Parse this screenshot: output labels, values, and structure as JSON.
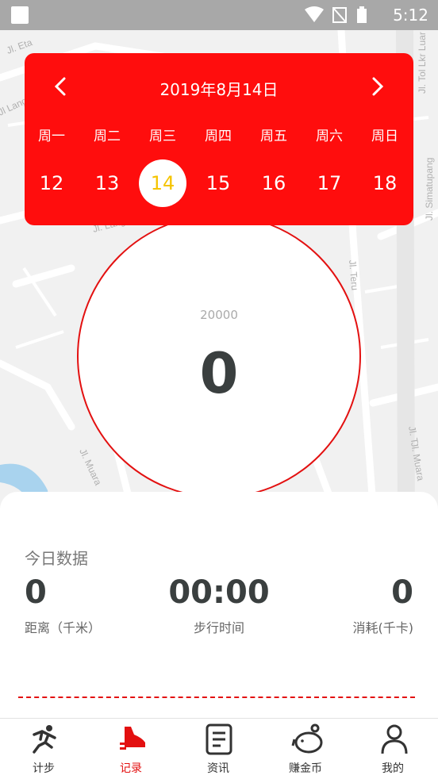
{
  "status_bar": {
    "time": "5:12"
  },
  "map": {
    "street_labels": [
      "Jl. Eta",
      "Jl. Langg",
      "Jl Langgu",
      "Jl. Teru",
      "Jl. Muara",
      "Jl. Muara",
      "Jl. Tol Lkr Luar Jkt",
      "Jl. Simatupang",
      "Jl. T"
    ]
  },
  "calendar": {
    "title": "2019年8月14日",
    "weekdays": [
      "周一",
      "周二",
      "周三",
      "周四",
      "周五",
      "周六",
      "周日"
    ],
    "days": [
      "12",
      "13",
      "14",
      "15",
      "16",
      "17",
      "18"
    ],
    "selected_index": 2,
    "selected_color": "#f5c400",
    "accent": "#ff0d0d"
  },
  "progress": {
    "goal": "20000",
    "steps": "0"
  },
  "today": {
    "label": "今日数据",
    "stats": [
      {
        "value": "0",
        "label": "距离（千米）"
      },
      {
        "value": "00:00",
        "label": "步行时间"
      },
      {
        "value": "0",
        "label": "消耗(千卡)"
      }
    ]
  },
  "tabbar": {
    "tabs": [
      {
        "label": "计步",
        "icon": "runner-icon"
      },
      {
        "label": "记录",
        "icon": "shoe-icon"
      },
      {
        "label": "资讯",
        "icon": "news-icon"
      },
      {
        "label": "赚金币",
        "icon": "piggy-bank-icon"
      },
      {
        "label": "我的",
        "icon": "user-icon"
      }
    ],
    "active_index": 1,
    "active_color": "#e31010"
  }
}
